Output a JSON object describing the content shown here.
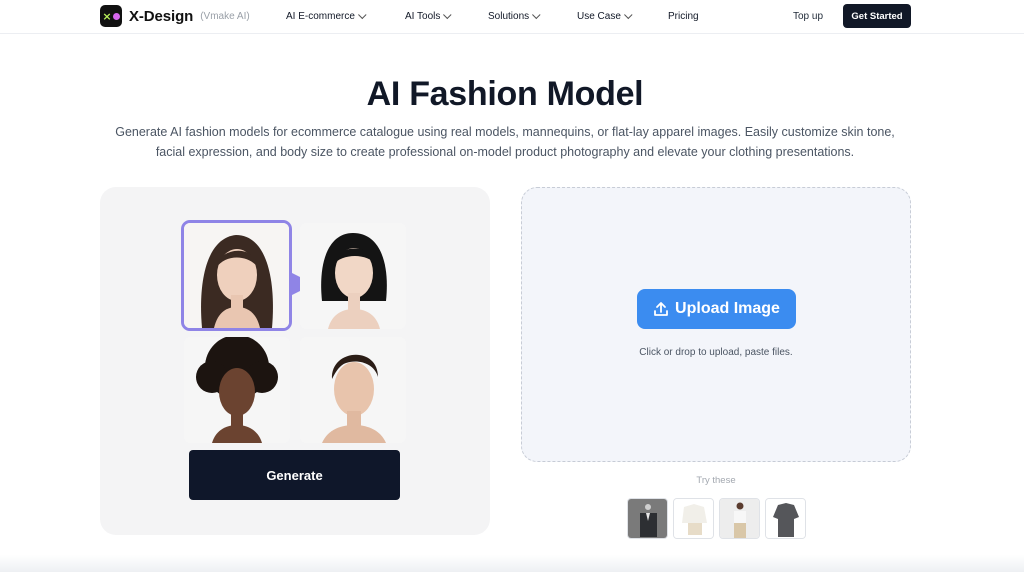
{
  "header": {
    "brand": "X-Design",
    "brand_sub": "(Vmake AI)",
    "nav": [
      {
        "label": "AI E-commerce"
      },
      {
        "label": "AI Tools"
      },
      {
        "label": "Solutions"
      },
      {
        "label": "Use Case"
      },
      {
        "label": "Pricing"
      }
    ],
    "top_up": "Top up",
    "get_started": "Get Started"
  },
  "hero": {
    "title": "AI Fashion Model",
    "subtitle": "Generate AI fashion models for ecommerce catalogue using real models, mannequins, or flat-lay apparel images. Easily customize skin tone, facial expression, and body size to create professional on-model product photography and elevate your clothing presentations."
  },
  "demo": {
    "generate_label": "Generate"
  },
  "upload": {
    "button_label": "Upload Image",
    "hint": "Click or drop to upload, paste files.",
    "try_label": "Try these"
  },
  "colors": {
    "accent_blue": "#3b8cf0",
    "selection_purple": "#8f84e6",
    "dark": "#0f172a"
  }
}
